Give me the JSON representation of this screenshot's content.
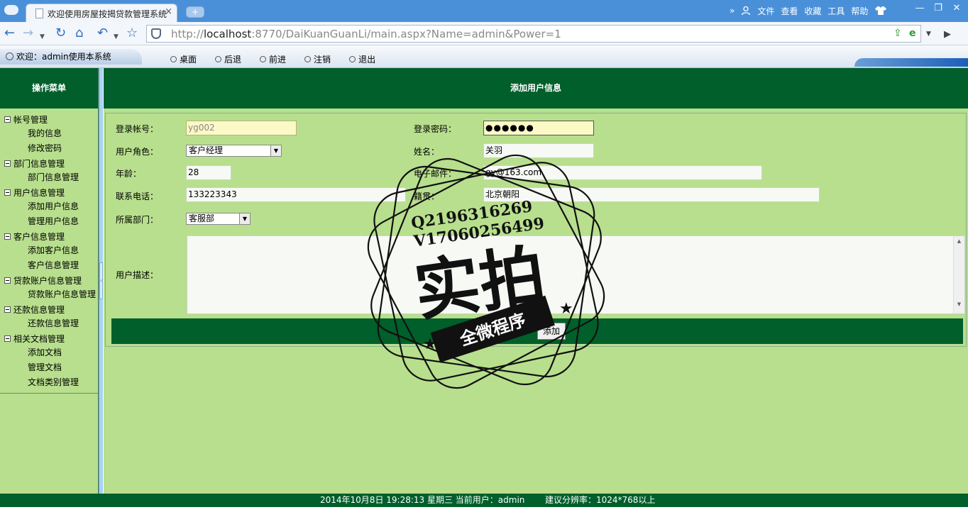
{
  "browser": {
    "tab_title": "欢迎使用房屋按揭贷款管理系统",
    "tab_close": "×",
    "new_tab": "+",
    "url_prefix": "http://",
    "url_host": "localhost",
    "url_rest": ":8770/DaiKuanGuanLi/main.aspx?Name=admin&Power=1",
    "menu": {
      "more": "»",
      "file": "文件",
      "view": "查看",
      "favorites": "收藏",
      "tools": "工具",
      "help": "帮助"
    }
  },
  "favbar": {
    "welcome": "欢迎：admin使用本系统",
    "links": [
      "桌面",
      "后退",
      "前进",
      "注销",
      "退出"
    ]
  },
  "sidebar": {
    "title": "操作菜单",
    "groups": [
      {
        "label": "帐号管理",
        "items": [
          "我的信息",
          "修改密码"
        ]
      },
      {
        "label": "部门信息管理",
        "items": [
          "部门信息管理"
        ]
      },
      {
        "label": "用户信息管理",
        "items": [
          "添加用户信息",
          "管理用户信息"
        ]
      },
      {
        "label": "客户信息管理",
        "items": [
          "添加客户信息",
          "客户信息管理"
        ]
      },
      {
        "label": "贷款账户信息管理",
        "items": [
          "贷款账户信息管理"
        ]
      },
      {
        "label": "还款信息管理",
        "items": [
          "还款信息管理"
        ]
      },
      {
        "label": "相关文档管理",
        "items": [
          "添加文档",
          "管理文档",
          "文档类别管理"
        ]
      }
    ]
  },
  "main": {
    "title": "添加用户信息",
    "form": {
      "account_label": "登录帐号：",
      "account_value": "yg002",
      "password_label": "登录密码：",
      "password_value": "●●●●●●",
      "role_label": "用户角色：",
      "role_value": "客户经理",
      "name_label": "姓名：",
      "name_value": "关羽",
      "age_label": "年龄：",
      "age_value": "28",
      "email_label": "电子邮件：",
      "email_value": "gy@163.com",
      "phone_label": "联系电话：",
      "phone_value": "133223343",
      "origin_label": "籍贯：",
      "origin_value": "北京朝阳",
      "dept_label": "所属部门：",
      "dept_value": "客服部",
      "desc_label": "用户描述：",
      "desc_value": "",
      "submit_label": "添加"
    }
  },
  "footer": {
    "datetime_user": "2014年10月8日 19:28:13 星期三   当前用户：admin",
    "resolution": "建议分辨率：1024*768以上"
  },
  "watermark": {
    "line1": "Q2196316269",
    "line2": "V17060256499",
    "main": "实拍",
    "ribbon": "全微程序"
  }
}
